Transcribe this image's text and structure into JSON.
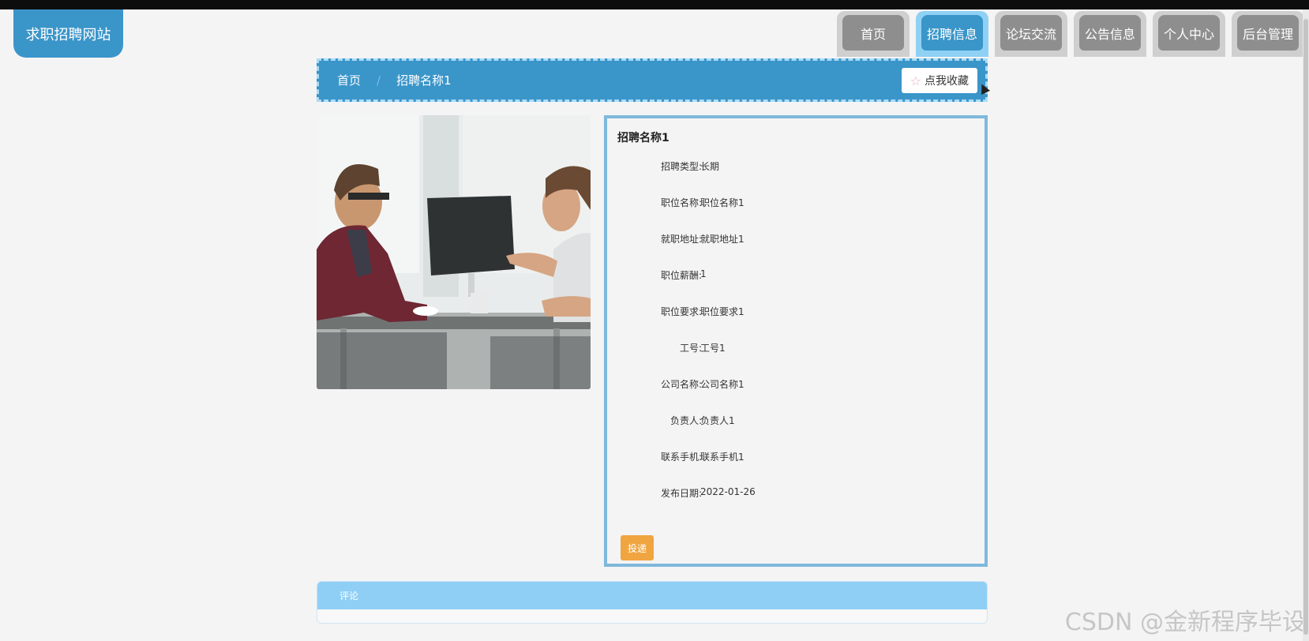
{
  "site": {
    "logo": "求职招聘网站"
  },
  "nav": [
    {
      "label": "首页",
      "active": false
    },
    {
      "label": "招聘信息",
      "active": true
    },
    {
      "label": "论坛交流",
      "active": false
    },
    {
      "label": "公告信息",
      "active": false
    },
    {
      "label": "个人中心",
      "active": false
    },
    {
      "label": "后台管理",
      "active": false
    }
  ],
  "breadcrumb": {
    "home": "首页",
    "separator": "/",
    "current": "招聘名称1"
  },
  "favorite": {
    "icon": "star-icon",
    "label": "点我收藏"
  },
  "detail": {
    "title": "招聘名称1",
    "fields": [
      {
        "label": "招聘类型:",
        "value": "长期"
      },
      {
        "label": "职位名称:",
        "value": "职位名称1"
      },
      {
        "label": "就职地址:",
        "value": "就职地址1"
      },
      {
        "label": "职位薪酬:",
        "value": "1"
      },
      {
        "label": "职位要求:",
        "value": "职位要求1"
      },
      {
        "label": "工号:",
        "value": "工号1"
      },
      {
        "label": "公司名称:",
        "value": "公司名称1"
      },
      {
        "label": "负责人:",
        "value": "负责人1"
      },
      {
        "label": "联系手机:",
        "value": "联系手机1"
      },
      {
        "label": "发布日期:",
        "value": "2022-01-26"
      }
    ],
    "submit_label": "投递"
  },
  "comment": {
    "title": "评论"
  },
  "watermark": "CSDN @金新程序毕设",
  "colors": {
    "primary": "#3a95c9",
    "light": "#8fcff6",
    "accent": "#f0a541"
  }
}
